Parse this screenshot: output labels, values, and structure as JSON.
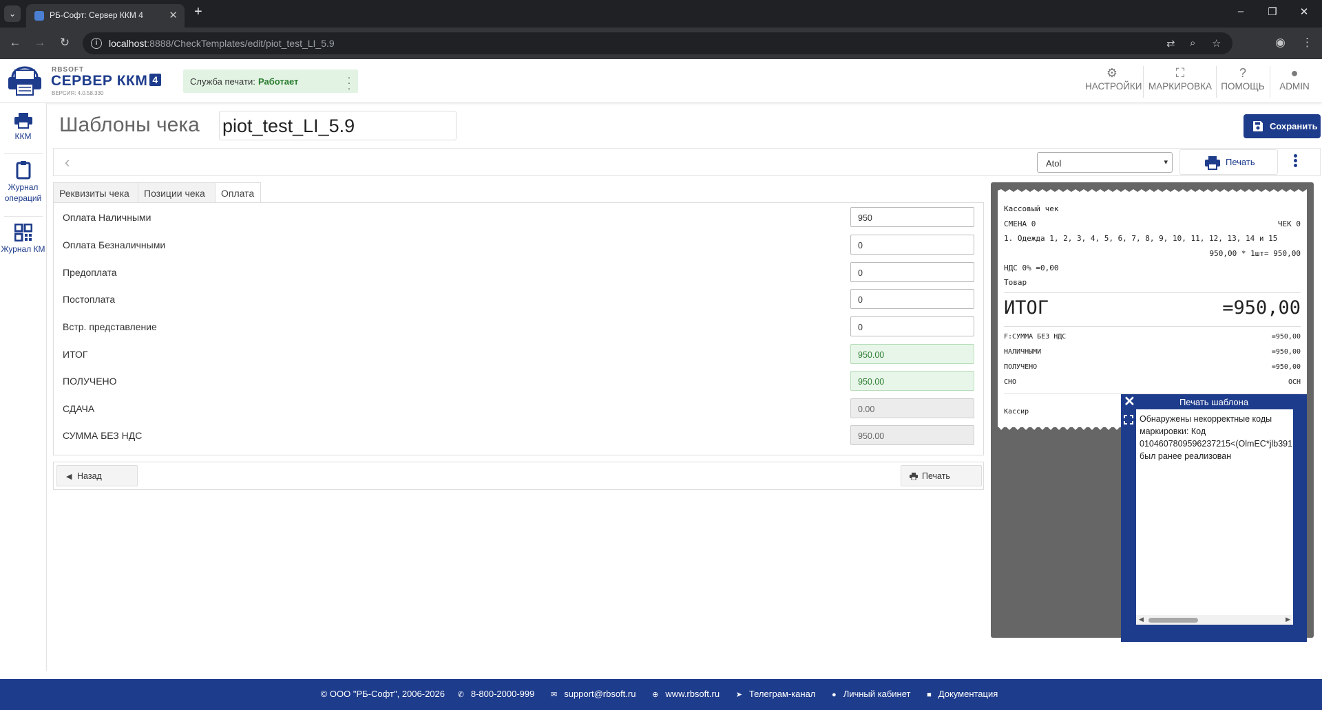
{
  "browser": {
    "tab_title": "РБ-Софт: Сервер ККМ 4",
    "url_host": "localhost",
    "url_rest": ":8888/CheckTemplates/edit/piot_test_LI_5.9"
  },
  "header": {
    "brand": "RBSOFT",
    "product": "СЕРВЕР ККМ",
    "product_num": "4",
    "version": "ВЕРСИЯ: 4.0.58.330",
    "print_service_label": "Служба печати:",
    "print_service_status": "Работает",
    "nav": {
      "settings": "НАСТРОЙКИ",
      "marking": "МАРКИРОВКА",
      "help": "ПОМОЩЬ",
      "admin": "ADMIN"
    }
  },
  "sidebar": {
    "items": [
      {
        "label": "ККМ"
      },
      {
        "label": "Журнал операций"
      },
      {
        "label": "Журнал КМ"
      }
    ]
  },
  "page": {
    "title": "Шаблоны чека",
    "template_name": "piot_test_LI_5.9",
    "save_label": "Сохранить"
  },
  "toolbar": {
    "driver_selected": "Atol",
    "print_label": "Печать"
  },
  "tabs": [
    {
      "label": "Реквизиты чека"
    },
    {
      "label": "Позиции чека"
    },
    {
      "label": "Оплата",
      "active": true
    }
  ],
  "payment": {
    "rows": [
      {
        "label": "Оплата Наличными",
        "value": "950",
        "state": "editable"
      },
      {
        "label": "Оплата Безналичными",
        "value": "0",
        "state": "editable"
      },
      {
        "label": "Предоплата",
        "value": "0",
        "state": "editable"
      },
      {
        "label": "Постоплата",
        "value": "0",
        "state": "editable"
      },
      {
        "label": "Встр. представление",
        "value": "0",
        "state": "editable"
      },
      {
        "label": "ИТОГ",
        "value": "950.00",
        "state": "valid"
      },
      {
        "label": "ПОЛУЧЕНО",
        "value": "950.00",
        "state": "valid"
      },
      {
        "label": "СДАЧА",
        "value": "0.00",
        "state": "readonly"
      },
      {
        "label": "СУММА БЕЗ НДС",
        "value": "950.00",
        "state": "readonly"
      }
    ],
    "back_label": "Назад",
    "print_label": "Печать"
  },
  "receipt": {
    "title": "Кассовый чек",
    "shift": "СМЕНА 0",
    "check": "ЧЕК 0",
    "item_line": "1. Одежда 1, 2, 3, 4, 5, 6, 7, 8, 9, 10, 11, 12, 13, 14 и 15",
    "item_price": "950,00 * 1шт= 950,00",
    "vat": "НДС 0% =0,00",
    "item_type": "Товар",
    "total_label": "ИТОГ",
    "total_value": "=950,00",
    "lines": [
      {
        "label": "F:СУММА БЕЗ НДС",
        "value": "=950,00"
      },
      {
        "label": "НАЛИЧНЫМИ",
        "value": "=950,00"
      },
      {
        "label": "ПОЛУЧЕНО",
        "value": "=950,00"
      },
      {
        "label": "СНО",
        "value": "ОСН"
      }
    ],
    "cashier": "Кассир"
  },
  "popup": {
    "title": "Печать шаблона",
    "message": "Обнаружены некорректные коды\nмаркировки: Код\n0104607809596237215<(OlmEC*jlb391\nбыл ранее реализован"
  },
  "footer": {
    "copyright": "© ООО \"РБ-Софт\", 2006-2026",
    "phone": "8-800-2000-999",
    "email": "support@rbsoft.ru",
    "site": "www.rbsoft.ru",
    "telegram": "Телеграм-канал",
    "cabinet": "Личный кабинет",
    "docs": "Документация"
  },
  "colors": {
    "brand_blue": "#1e3c8c",
    "status_green": "#2d7d32",
    "valid_bg": "#e8f6e9",
    "preview_bg": "#666666"
  }
}
